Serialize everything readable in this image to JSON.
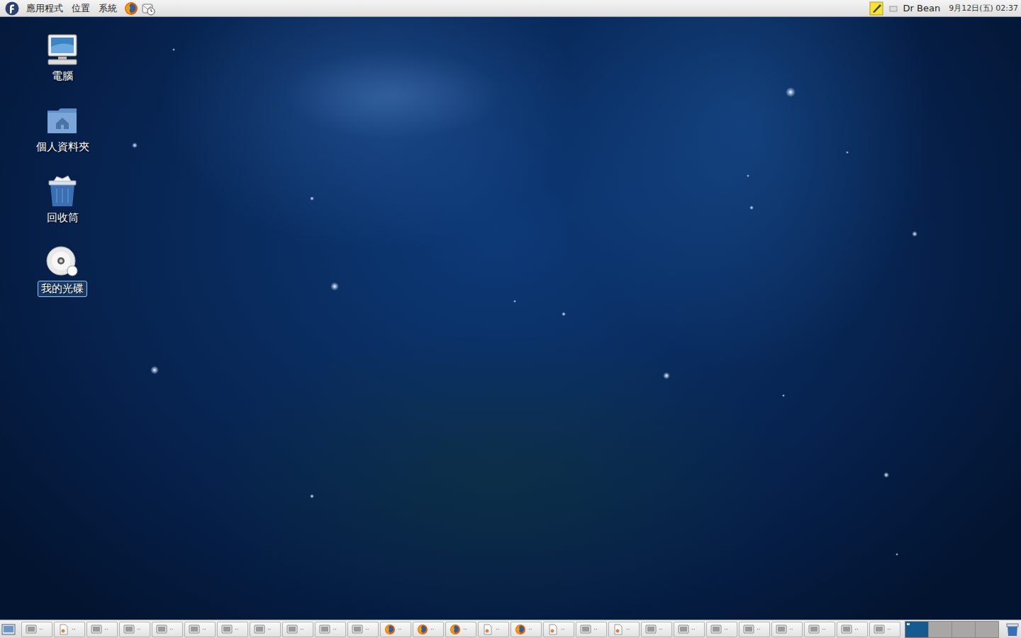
{
  "top_panel": {
    "menus": [
      {
        "label": "應用程式"
      },
      {
        "label": "位置"
      },
      {
        "label": "系統"
      }
    ],
    "user": "Dr Bean",
    "clock": "9月12日(五) 02:37"
  },
  "desktop_icons": [
    {
      "label": "電腦",
      "kind": "computer",
      "selected": false
    },
    {
      "label": "個人資料夾",
      "kind": "home",
      "selected": false
    },
    {
      "label": "回收筒",
      "kind": "trash",
      "selected": false
    },
    {
      "label": "我的光碟",
      "kind": "cd",
      "selected": true
    }
  ],
  "taskbar": {
    "buttons": [
      {
        "kind": "terminal",
        "label": "··",
        "selected": false
      },
      {
        "kind": "document",
        "label": "··",
        "selected": false
      },
      {
        "kind": "terminal",
        "label": "··",
        "selected": false
      },
      {
        "kind": "terminal",
        "label": "··",
        "selected": false
      },
      {
        "kind": "terminal",
        "label": "··",
        "selected": false
      },
      {
        "kind": "terminal",
        "label": "··",
        "selected": false
      },
      {
        "kind": "terminal",
        "label": "··",
        "selected": false
      },
      {
        "kind": "terminal",
        "label": "··",
        "selected": false
      },
      {
        "kind": "terminal",
        "label": "··",
        "selected": false
      },
      {
        "kind": "terminal",
        "label": "··",
        "selected": false
      },
      {
        "kind": "terminal",
        "label": "··",
        "selected": false
      },
      {
        "kind": "firefox",
        "label": "··",
        "selected": false
      },
      {
        "kind": "firefox",
        "label": "··",
        "selected": false
      },
      {
        "kind": "firefox",
        "label": "··",
        "selected": false
      },
      {
        "kind": "document",
        "label": "··",
        "selected": false
      },
      {
        "kind": "firefox",
        "label": "··",
        "selected": false
      },
      {
        "kind": "document",
        "label": "··",
        "selected": false
      },
      {
        "kind": "terminal",
        "label": "··",
        "selected": false
      },
      {
        "kind": "document",
        "label": "··",
        "selected": false
      },
      {
        "kind": "terminal",
        "label": "··",
        "selected": false
      },
      {
        "kind": "terminal",
        "label": "··",
        "selected": false
      },
      {
        "kind": "terminal",
        "label": "··",
        "selected": false
      },
      {
        "kind": "terminal",
        "label": "··",
        "selected": false
      },
      {
        "kind": "terminal",
        "label": "··",
        "selected": false
      },
      {
        "kind": "terminal",
        "label": "··",
        "selected": false
      },
      {
        "kind": "terminal",
        "label": "··",
        "selected": false
      },
      {
        "kind": "terminal",
        "label": "··",
        "selected": false
      }
    ],
    "workspaces": [
      {
        "selected": true
      },
      {
        "selected": false
      },
      {
        "selected": false
      },
      {
        "selected": false
      }
    ]
  }
}
